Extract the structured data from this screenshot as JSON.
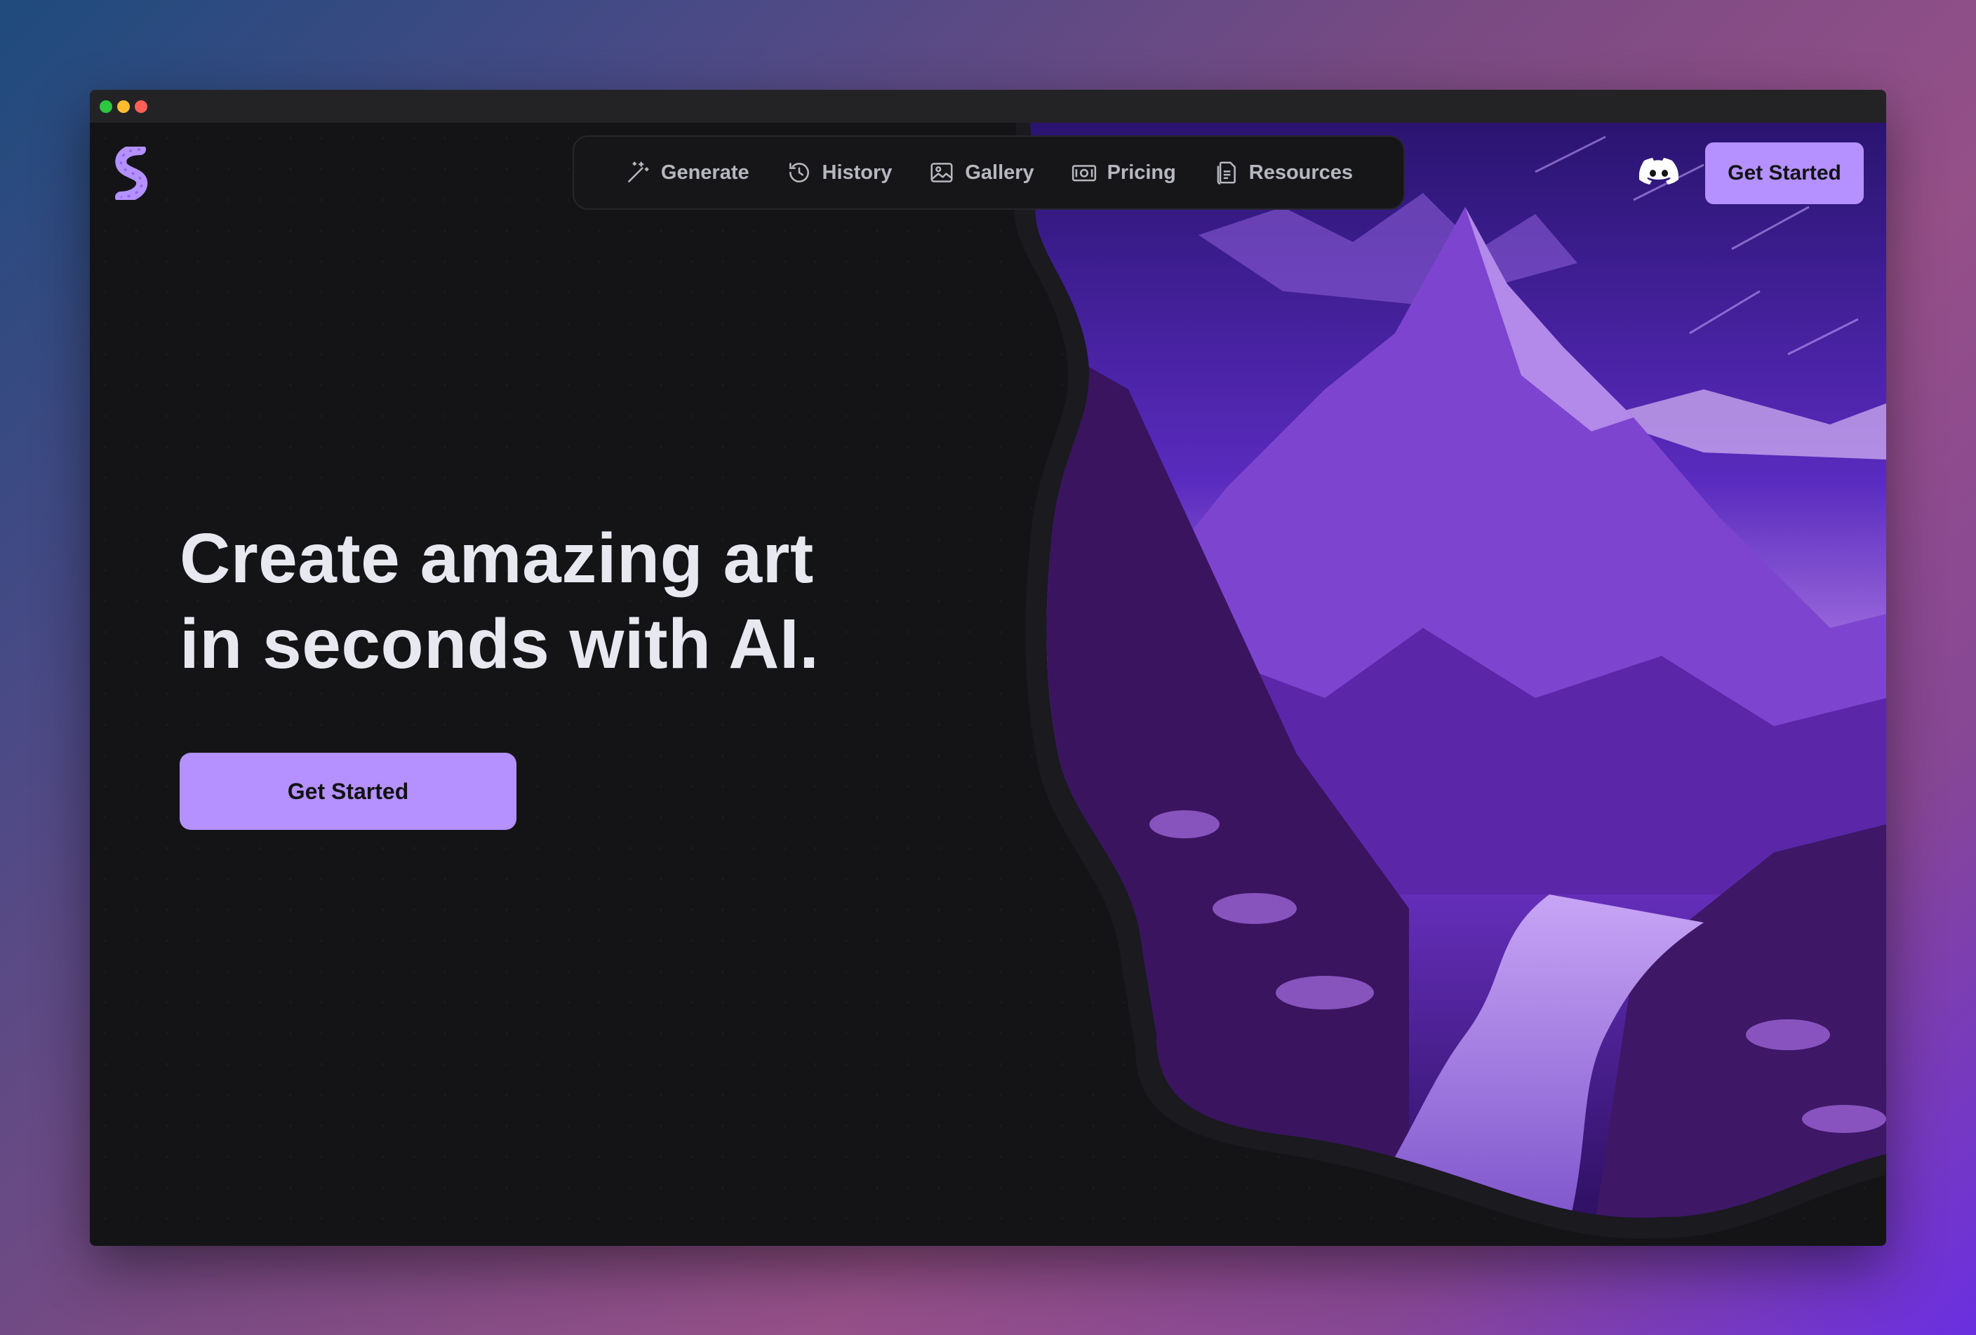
{
  "window": {
    "controls": [
      "close",
      "minimize",
      "zoom"
    ]
  },
  "header": {
    "logo_icon": "s-logo-icon",
    "nav": [
      {
        "label": "Generate",
        "icon": "magic-wand-icon"
      },
      {
        "label": "History",
        "icon": "history-clock-icon"
      },
      {
        "label": "Gallery",
        "icon": "image-icon"
      },
      {
        "label": "Pricing",
        "icon": "money-icon"
      },
      {
        "label": "Resources",
        "icon": "document-icon"
      }
    ],
    "discord_icon": "discord-icon",
    "cta_label": "Get Started"
  },
  "hero": {
    "headline_line1": "Create amazing art",
    "headline_line2": "in seconds with AI.",
    "cta_label": "Get Started",
    "image_subject": "purple mountain landscape with stone path"
  },
  "colors": {
    "accent": "#b491ff",
    "background": "#141417",
    "nav_text": "#b7b7c0",
    "headline": "#e8e8f0"
  }
}
